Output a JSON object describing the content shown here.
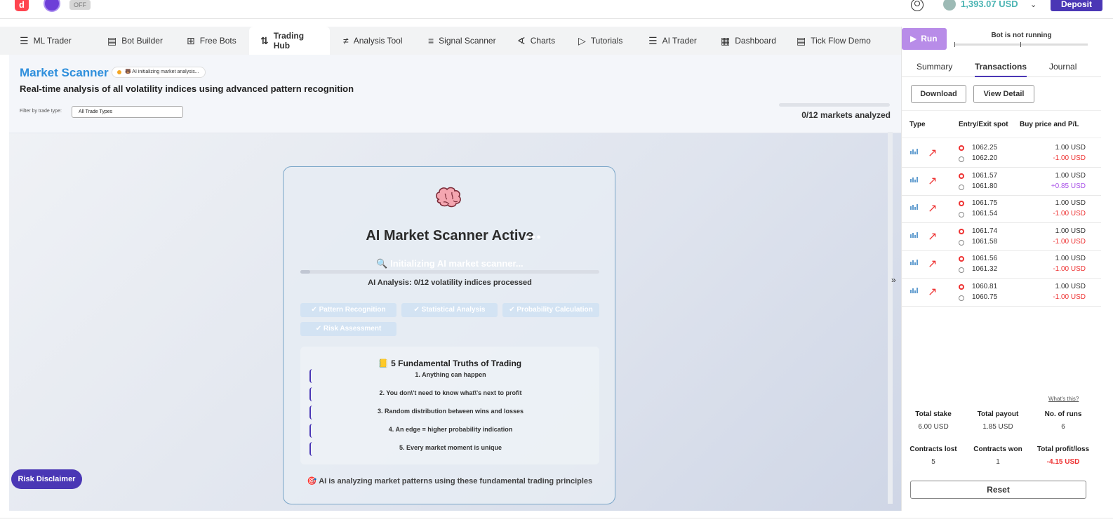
{
  "topbar": {
    "logo": "d",
    "off_label": "OFF",
    "balance": "1,393.07 USD",
    "deposit_label": "Deposit"
  },
  "tabs": [
    {
      "label": "ML Trader",
      "icon": "layers-icon"
    },
    {
      "label": "Bot Builder",
      "icon": "builder-icon"
    },
    {
      "label": "Free Bots",
      "icon": "grid-plus-icon"
    },
    {
      "label": "Trading Hub",
      "icon": "up-down-arrows-icon"
    },
    {
      "label": "Analysis Tool",
      "icon": "candles-icon"
    },
    {
      "label": "Signal Scanner",
      "icon": "list-icon"
    },
    {
      "label": "Charts",
      "icon": "chart-line-icon"
    },
    {
      "label": "Tutorials",
      "icon": "video-icon"
    },
    {
      "label": "AI Trader",
      "icon": "layers-icon"
    },
    {
      "label": "Dashboard",
      "icon": "dashboard-icon"
    },
    {
      "label": "Tick Flow Demo",
      "icon": "builder-icon"
    }
  ],
  "scanner": {
    "title": "Market Scanner",
    "status": "🐻 AI initializing market analysis...",
    "subtitle": "Real-time analysis of all volatility indices using advanced pattern recognition",
    "filter_label": "Filter by trade type:",
    "filter_value": "All Trade Types",
    "markets_analyzed": "0/12 markets analyzed"
  },
  "card": {
    "title": "AI Market Scanner Active",
    "scan_text": "Initializing AI market scanner...",
    "analysis": "AI Analysis: 0/12 volatility indices processed",
    "chips": [
      "✔ Pattern Recognition",
      "✔ Statistical Analysis",
      "✔ Probability Calculation",
      "✔ Risk Assessment"
    ],
    "truths_title": "5 Fundamental Truths of Trading",
    "truths": [
      "1. Anything can happen",
      "2. You don\\'t need to know what\\'s next to profit",
      "3. Random distribution between wins and losses",
      "4. An edge = higher probability indication",
      "5. Every market moment is unique"
    ],
    "footer": "AI is analyzing market patterns using these fundamental trading principles"
  },
  "risk_label": "Risk Disclaimer",
  "right_panel": {
    "run_label": "Run",
    "bot_status": "Bot is not running",
    "tabs": [
      "Summary",
      "Transactions",
      "Journal"
    ],
    "download_label": "Download",
    "view_detail_label": "View Detail",
    "headers": [
      "Type",
      "Entry/Exit spot",
      "Buy price and P/L"
    ],
    "transactions": [
      {
        "entry": "1062.25",
        "exit": "1062.20",
        "buy": "1.00 USD",
        "pl": "-1.00 USD"
      },
      {
        "entry": "1061.57",
        "exit": "1061.80",
        "buy": "1.00 USD",
        "pl": "+0.85 USD"
      },
      {
        "entry": "1061.75",
        "exit": "1061.54",
        "buy": "1.00 USD",
        "pl": "-1.00 USD"
      },
      {
        "entry": "1061.74",
        "exit": "1061.58",
        "buy": "1.00 USD",
        "pl": "-1.00 USD"
      },
      {
        "entry": "1061.56",
        "exit": "1061.32",
        "buy": "1.00 USD",
        "pl": "-1.00 USD"
      },
      {
        "entry": "1060.81",
        "exit": "1060.75",
        "buy": "1.00 USD",
        "pl": "-1.00 USD"
      }
    ],
    "whats_this": "What's this?",
    "stats": {
      "total_stake_label": "Total stake",
      "total_stake": "6.00 USD",
      "total_payout_label": "Total payout",
      "total_payout": "1.85 USD",
      "runs_label": "No. of runs",
      "runs": "6",
      "lost_label": "Contracts lost",
      "lost": "5",
      "won_label": "Contracts won",
      "won": "1",
      "profit_label": "Total profit/loss",
      "profit": "-4.15 USD"
    },
    "reset_label": "Reset"
  },
  "colors": {
    "accent": "#4a37b5",
    "title_blue": "#2f8fdc",
    "loss": "#e33333",
    "profit": "#a951e8",
    "run": "#b88ce8"
  }
}
